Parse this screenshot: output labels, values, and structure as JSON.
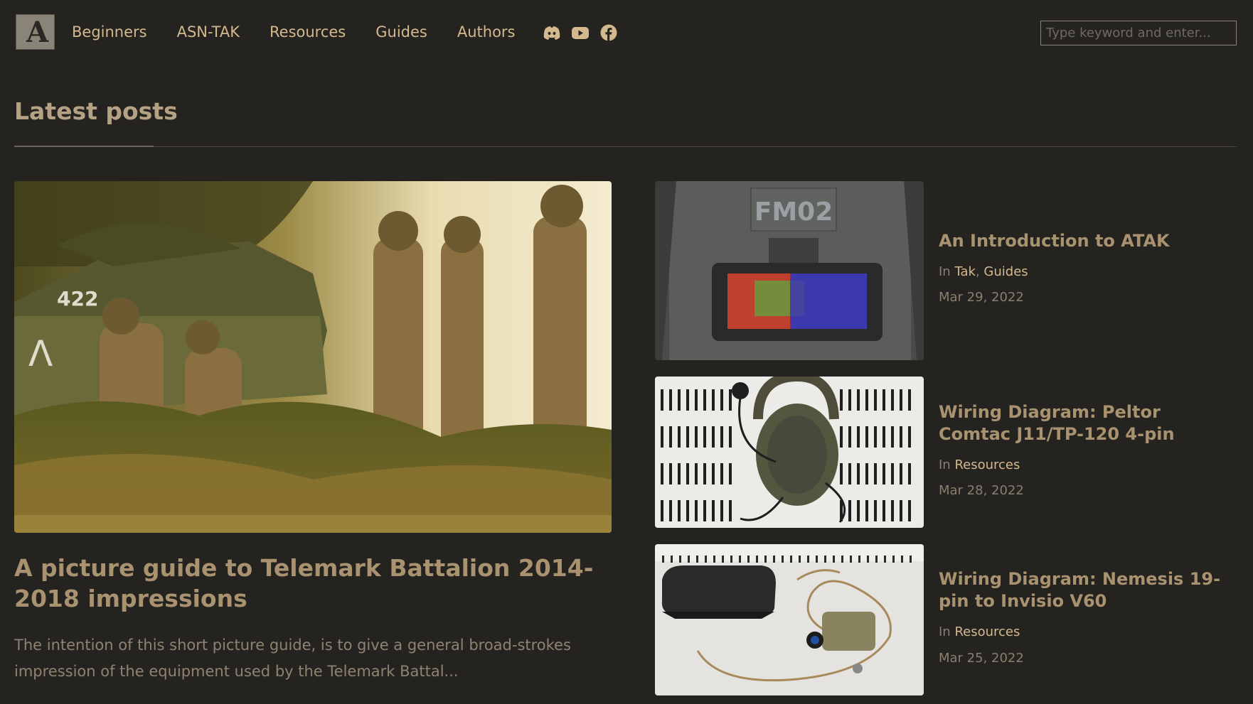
{
  "header": {
    "logo_text": "A",
    "nav": [
      "Beginners",
      "ASN-TAK",
      "Resources",
      "Guides",
      "Authors"
    ],
    "social_icons": [
      "discord-icon",
      "youtube-icon",
      "facebook-icon"
    ],
    "search_placeholder": "Type keyword and enter..."
  },
  "section_title": "Latest posts",
  "featured": {
    "title": "A picture guide to Telemark Battalion 2014-2018 impressions",
    "excerpt": "The intention of this short picture guide, is to give a general broad-strokes impression of the equipment used by the Telemark Battal..."
  },
  "posts": [
    {
      "title": "An Introduction to ATAK",
      "in_label": "In",
      "categories": [
        "Tak",
        "Guides"
      ],
      "separator": ",",
      "date": "Mar 29, 2022",
      "thumb_text": "FM02"
    },
    {
      "title": "Wiring Diagram: Peltor Comtac J11/TP-120 4-pin",
      "in_label": "In",
      "categories": [
        "Resources"
      ],
      "date": "Mar 28, 2022"
    },
    {
      "title": "Wiring Diagram: Nemesis 19-pin to Invisio V60",
      "in_label": "In",
      "categories": [
        "Resources"
      ],
      "date": "Mar 25, 2022"
    }
  ],
  "colors": {
    "background": "#252320",
    "accent": "#d4b98e",
    "title": "#a8926f"
  }
}
